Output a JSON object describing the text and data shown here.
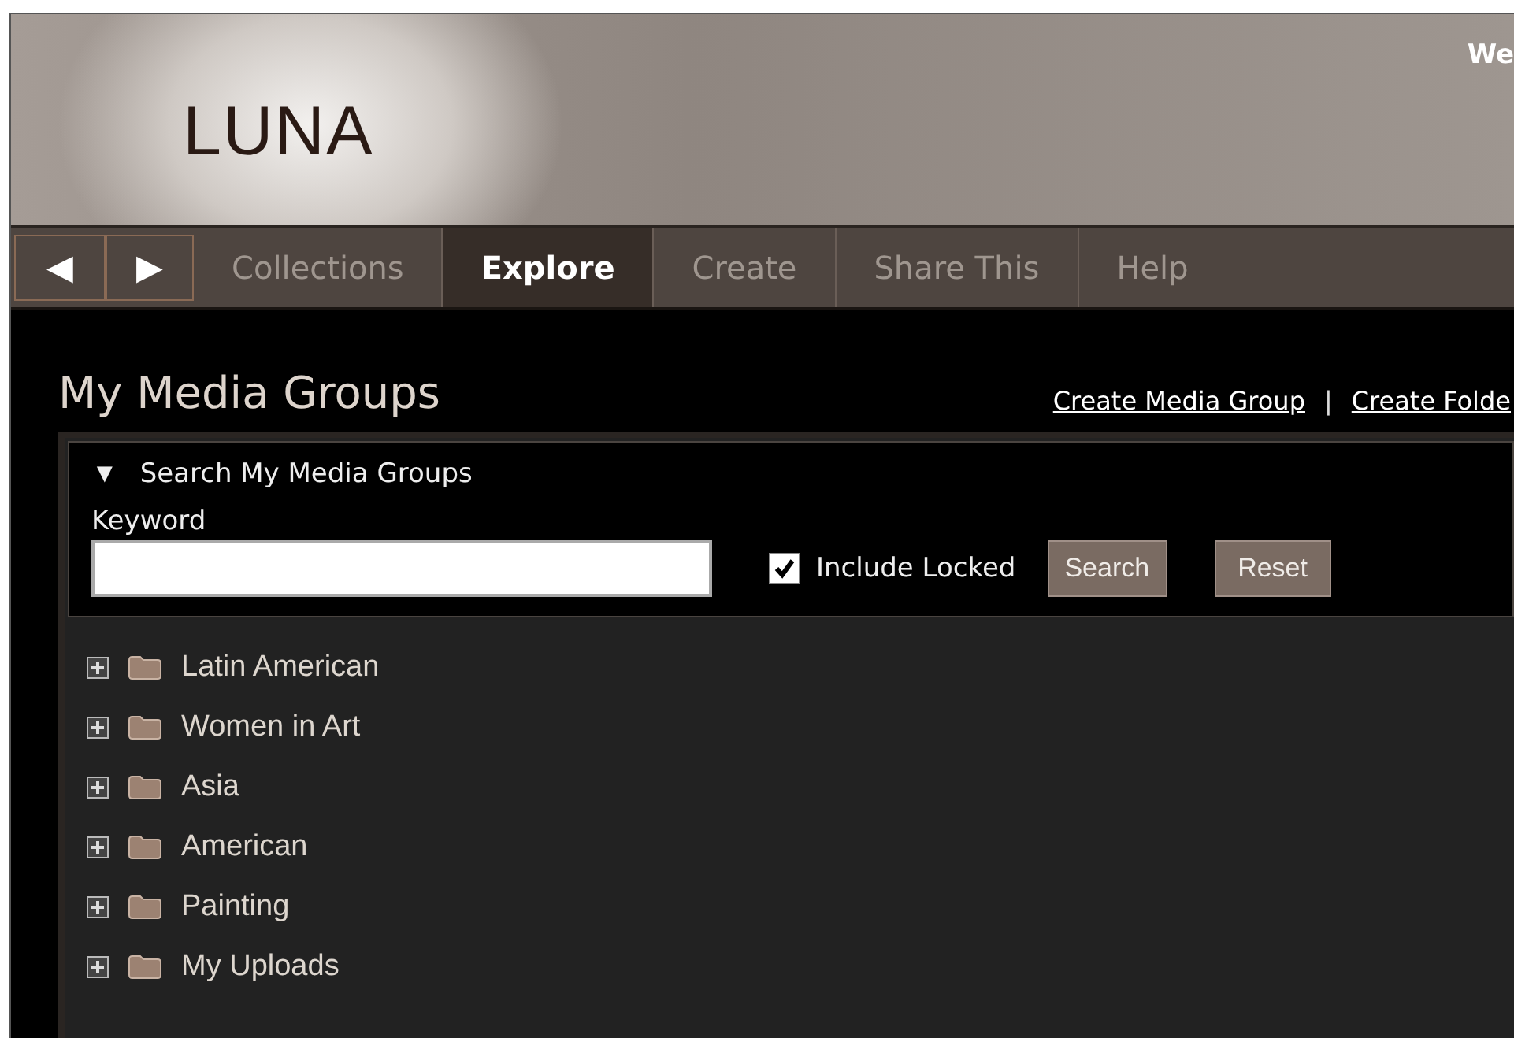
{
  "header": {
    "logo": "LUNA",
    "greeting": "We"
  },
  "nav": {
    "back": "◀",
    "forward": "▶",
    "tabs": [
      {
        "label": "Collections",
        "selected": false
      },
      {
        "label": "Explore",
        "selected": true
      },
      {
        "label": "Create",
        "selected": false
      },
      {
        "label": "Share This",
        "selected": false
      },
      {
        "label": "Help",
        "selected": false
      }
    ]
  },
  "page_title": "My Media Groups",
  "links": [
    "Create Media Group",
    "Create Folde"
  ],
  "link_separator": "|",
  "search": {
    "toggle": "▼",
    "title": "Search My Media Groups",
    "keyword_label": "Keyword",
    "include_locked": {
      "label": "Include Locked",
      "checked": true
    },
    "buttons": [
      "Search",
      "Reset"
    ]
  },
  "groups": [
    {
      "name": "Latin American",
      "expanded": false
    },
    {
      "name": "Women in Art",
      "expanded": false
    },
    {
      "name": "Asia",
      "expanded": false
    },
    {
      "name": "American",
      "expanded": false
    },
    {
      "name": "Painting",
      "expanded": false
    },
    {
      "name": "My Uploads",
      "expanded": false
    }
  ]
}
